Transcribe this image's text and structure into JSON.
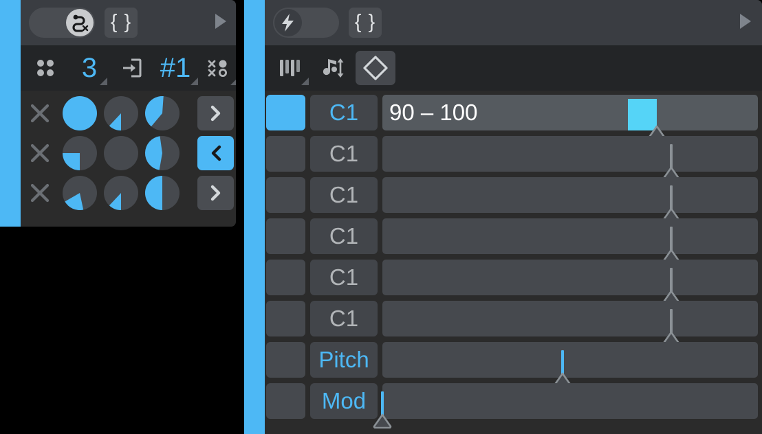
{
  "theme": {
    "accent": "#4db8f5",
    "accent_bright": "#55d4f7",
    "panel_bg": "#2b2b2b",
    "header_bg": "#3a3d42",
    "toolbar_bg": "#232527",
    "control_bg": "#46494e",
    "text_dim": "#b2b5b8",
    "text_bright": "#ffffff"
  },
  "left_panel": {
    "name": "modulation-matrix-panel",
    "header": {
      "toggle": {
        "icon": "path-route-x-icon",
        "state": "on",
        "state_label": "On"
      },
      "brace_button": {
        "icon": "curly-braces-icon",
        "label": "{ }"
      },
      "expand_arrow": {
        "icon": "play-triangle-icon"
      }
    },
    "toolbar": [
      {
        "icon": "four-dots-grid-icon",
        "label": "",
        "name": "grid-view-toggle",
        "has_corner": false
      },
      {
        "icon": "",
        "label": "3",
        "name": "slot-count-selector",
        "has_corner": true
      },
      {
        "icon": "arrow-into-box-icon",
        "label": "",
        "name": "input-routing-icon",
        "has_corner": false
      },
      {
        "icon": "",
        "label": "#1",
        "name": "preset-index",
        "has_corner": true
      },
      {
        "icon": "scatter-nodes-icon",
        "label": "",
        "name": "randomize-icon",
        "has_corner": true
      }
    ],
    "rows": [
      {
        "name": "matrix-row-1",
        "clear_icon": "x-close-icon",
        "pies": [
          {
            "name": "depth-dial-1a",
            "percent": 100,
            "start_deg": 0
          },
          {
            "name": "depth-dial-1b",
            "percent": 12,
            "start_deg": 180
          },
          {
            "name": "depth-dial-1c",
            "percent": 40,
            "start_deg": 220
          }
        ],
        "nav": {
          "icon": "chevron-right-icon",
          "label": "›",
          "active": false
        }
      },
      {
        "name": "matrix-row-2",
        "clear_icon": "x-close-icon",
        "pies": [
          {
            "name": "depth-dial-2a",
            "percent": 25,
            "start_deg": 180
          },
          {
            "name": "depth-dial-2b",
            "percent": 0,
            "start_deg": 0
          },
          {
            "name": "depth-dial-2c",
            "percent": 45,
            "start_deg": 190
          }
        ],
        "nav": {
          "icon": "chevron-left-icon",
          "label": "‹",
          "active": true
        }
      },
      {
        "name": "matrix-row-3",
        "clear_icon": "x-close-icon",
        "pies": [
          {
            "name": "depth-dial-3a",
            "percent": 20,
            "start_deg": 168
          },
          {
            "name": "depth-dial-3b",
            "percent": 12,
            "start_deg": 180
          },
          {
            "name": "depth-dial-3c",
            "percent": 50,
            "start_deg": 180
          }
        ],
        "nav": {
          "icon": "chevron-right-icon",
          "label": "›",
          "active": false
        }
      }
    ]
  },
  "right_panel": {
    "name": "note-lane-panel",
    "header": {
      "toggle": {
        "icon": "lightning-bolt-icon",
        "state": "off",
        "state_label": "Off"
      },
      "brace_button": {
        "icon": "curly-braces-icon",
        "label": "{ }"
      },
      "expand_arrow": {
        "icon": "play-triangle-icon"
      }
    },
    "toolbar": [
      {
        "icon": "piano-keys-icon",
        "name": "keyboard-mode-button",
        "has_corner": true,
        "selected": false
      },
      {
        "icon": "note-updown-icon",
        "name": "note-transpose-button",
        "has_corner": false,
        "selected": false
      },
      {
        "icon": "diamond-outline-icon",
        "name": "velocity-curve-button",
        "has_corner": false,
        "selected": true
      }
    ],
    "rows": [
      {
        "name": "lane-row-1",
        "enabled": true,
        "label": "C1",
        "label_accent": true,
        "value": "90 – 100",
        "slider": {
          "kind": "fill",
          "pos_pct": 73,
          "accent": true
        }
      },
      {
        "name": "lane-row-2",
        "enabled": false,
        "label": "C1",
        "label_accent": false,
        "value": "",
        "slider": {
          "kind": "needle",
          "pos_pct": 77,
          "accent": false
        }
      },
      {
        "name": "lane-row-3",
        "enabled": false,
        "label": "C1",
        "label_accent": false,
        "value": "",
        "slider": {
          "kind": "needle",
          "pos_pct": 77,
          "accent": false
        }
      },
      {
        "name": "lane-row-4",
        "enabled": false,
        "label": "C1",
        "label_accent": false,
        "value": "",
        "slider": {
          "kind": "needle",
          "pos_pct": 77,
          "accent": false
        }
      },
      {
        "name": "lane-row-5",
        "enabled": false,
        "label": "C1",
        "label_accent": false,
        "value": "",
        "slider": {
          "kind": "needle",
          "pos_pct": 77,
          "accent": false
        }
      },
      {
        "name": "lane-row-6",
        "enabled": false,
        "label": "C1",
        "label_accent": false,
        "value": "",
        "slider": {
          "kind": "needle",
          "pos_pct": 77,
          "accent": false
        }
      },
      {
        "name": "lane-row-7",
        "enabled": false,
        "label": "Pitch",
        "label_accent": true,
        "value": "",
        "slider": {
          "kind": "needle",
          "pos_pct": 48,
          "accent": true
        }
      },
      {
        "name": "lane-row-8",
        "enabled": false,
        "label": "Mod",
        "label_accent": true,
        "value": "",
        "slider": {
          "kind": "needle",
          "pos_pct": 0,
          "accent": true
        }
      }
    ]
  }
}
